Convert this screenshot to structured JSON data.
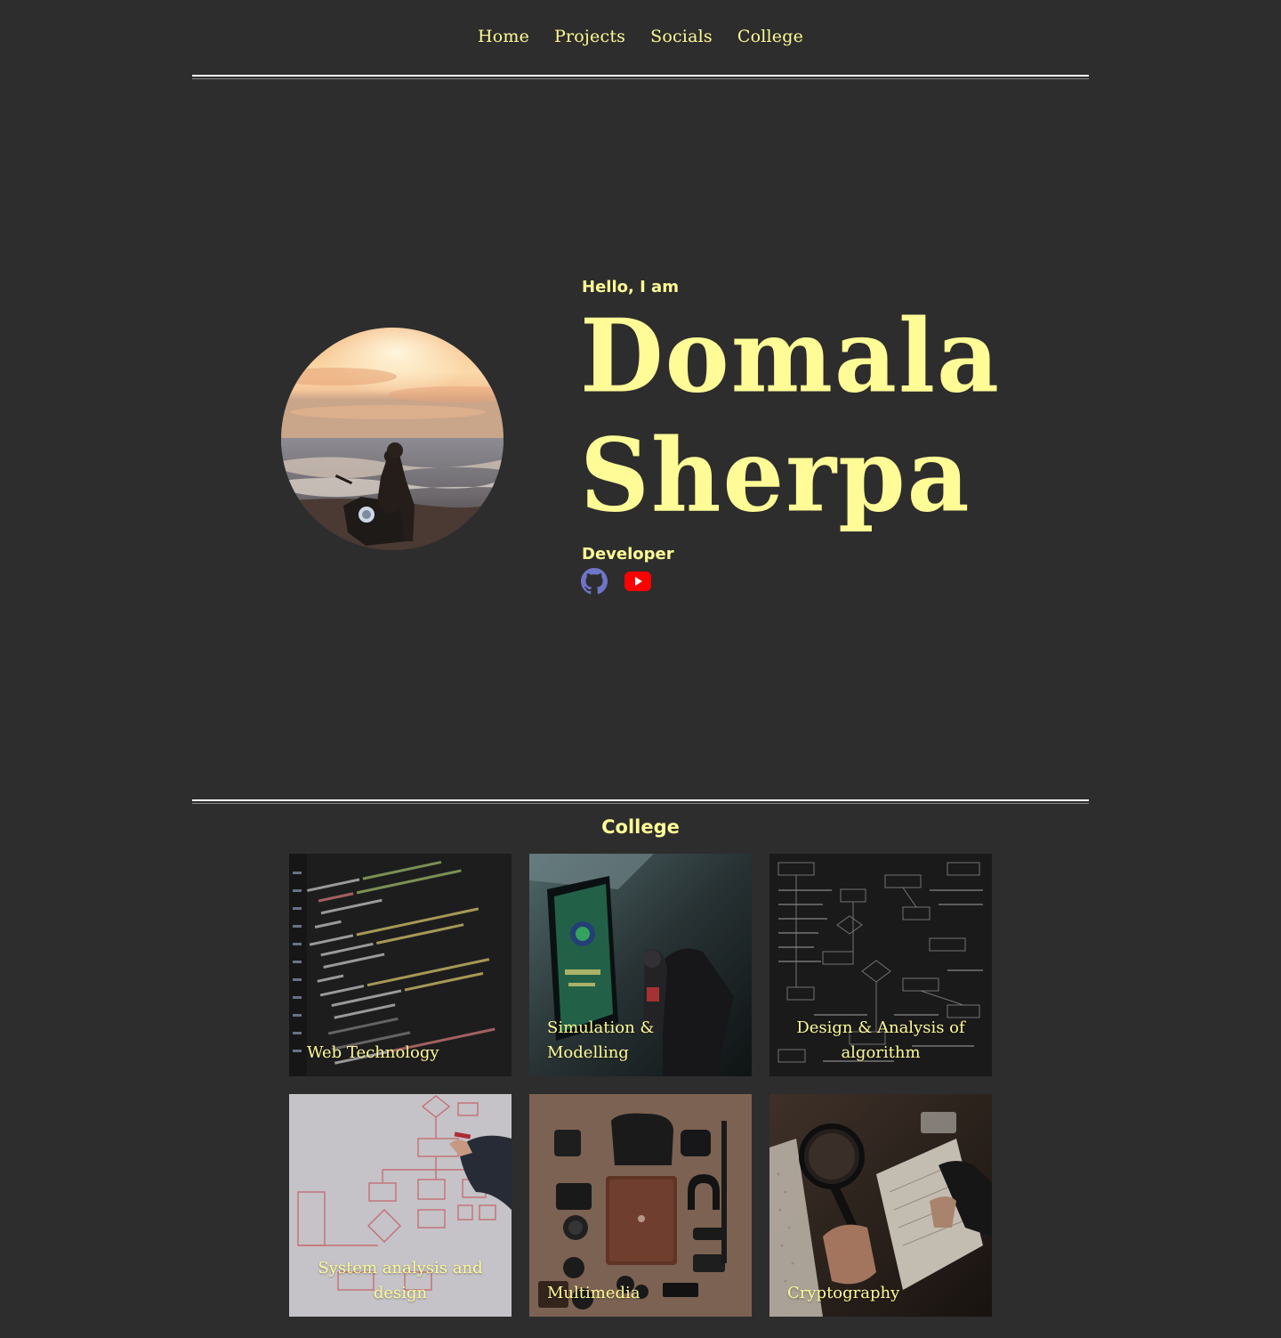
{
  "nav": {
    "items": [
      "Home",
      "Projects",
      "Socials",
      "College"
    ]
  },
  "hero": {
    "greeting": "Hello, I am",
    "first_name": "Domala",
    "last_name": "Sherpa",
    "role": "Developer",
    "socials": [
      {
        "name": "github-icon"
      },
      {
        "name": "youtube-icon"
      }
    ]
  },
  "college": {
    "title": "College",
    "courses": [
      {
        "label": "Web Technology"
      },
      {
        "label": "Simulation & Modelling"
      },
      {
        "label": "Design & Analysis of algorithm"
      },
      {
        "label": "System analysis and design"
      },
      {
        "label": "Multimedia"
      },
      {
        "label": "Cryptography"
      }
    ]
  },
  "colors": {
    "background": "#2d2d2d",
    "accent": "#fffb96",
    "github": "#6e75c9",
    "youtube": "#ff0000"
  }
}
